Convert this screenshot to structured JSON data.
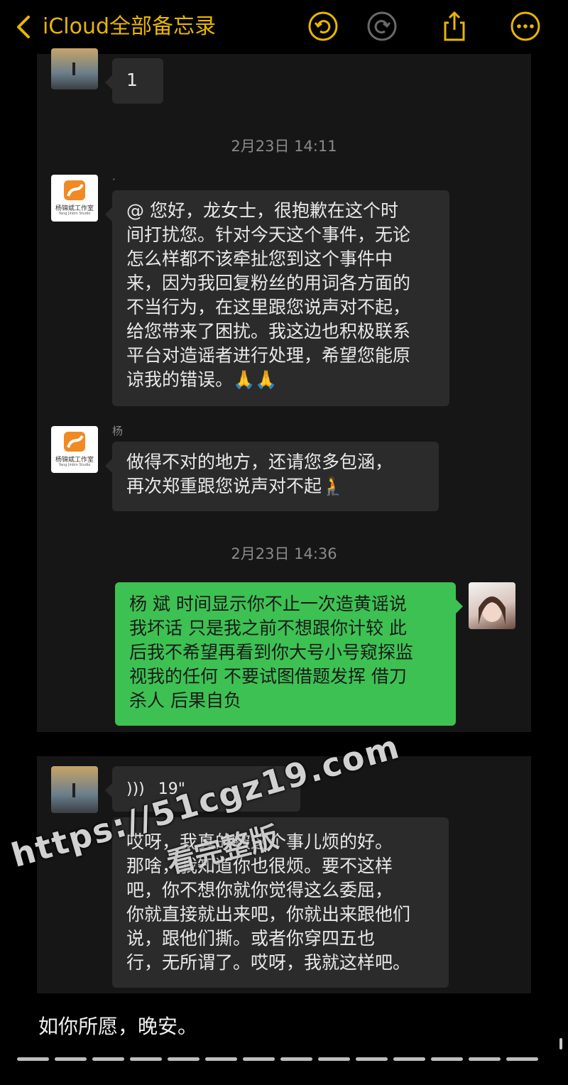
{
  "header": {
    "back_label": "iCloud全部备忘录",
    "icons": [
      "chevron-left-icon",
      "undo-icon",
      "redo-icon",
      "share-icon",
      "more-icon"
    ],
    "accent_color": "#e8b600"
  },
  "chat1": {
    "first_bubble": "1",
    "timestamp1": "2月23日 14:11",
    "msg1_lines": [
      "@     您好，龙女士，很抱歉在这个时",
      "间打扰您。针对今天这个事件，无论",
      "怎么样都不该牵扯您到这个事件中",
      "来，因为我回复粉丝的用词各方面的",
      "不当行为，在这里跟您说声对不起，",
      "给您带来了困扰。我这边也积极联系",
      "平台对造谣者进行处理，希望您能原",
      "谅我的错误。🙏🙏"
    ],
    "sender2": "杨",
    "msg2_lines": [
      "   做得不对的地方，还请您多包涵，",
      "再次郑重跟您说声对不起🧎"
    ],
    "timestamp2": "2月23日 14:36",
    "msg3_lines": [
      "杨     斌 时间显示你不止一次造黄谣说",
      "我坏话 只是我之前不想跟你计较 此",
      "后我不希望再看到你大号小号窥探监",
      "视我的任何 不要试图借题发挥 借刀",
      "杀人 后果自负"
    ],
    "studio_logo_text": "杨锦斌工作室",
    "studio_logo_subtext": "Yang Jinbin Studio"
  },
  "chat2": {
    "voice_duration": "19\"",
    "transcript_lines": [
      "哎呀，我真的被这个事儿烦的好。",
      "那啥，我知道你也很烦。要不这样",
      "吧，你不想你就你觉得这么委屈，",
      "你就直接就出来吧，你就出来跟他们",
      "说，跟他们撕。或者你穿四五也",
      "行，无所谓了。哎呀，我就这样吧。"
    ]
  },
  "footer_text": "如你所愿，晚安。",
  "watermark_url": "https://51cgz19.com",
  "watermark_text": "看完整版"
}
